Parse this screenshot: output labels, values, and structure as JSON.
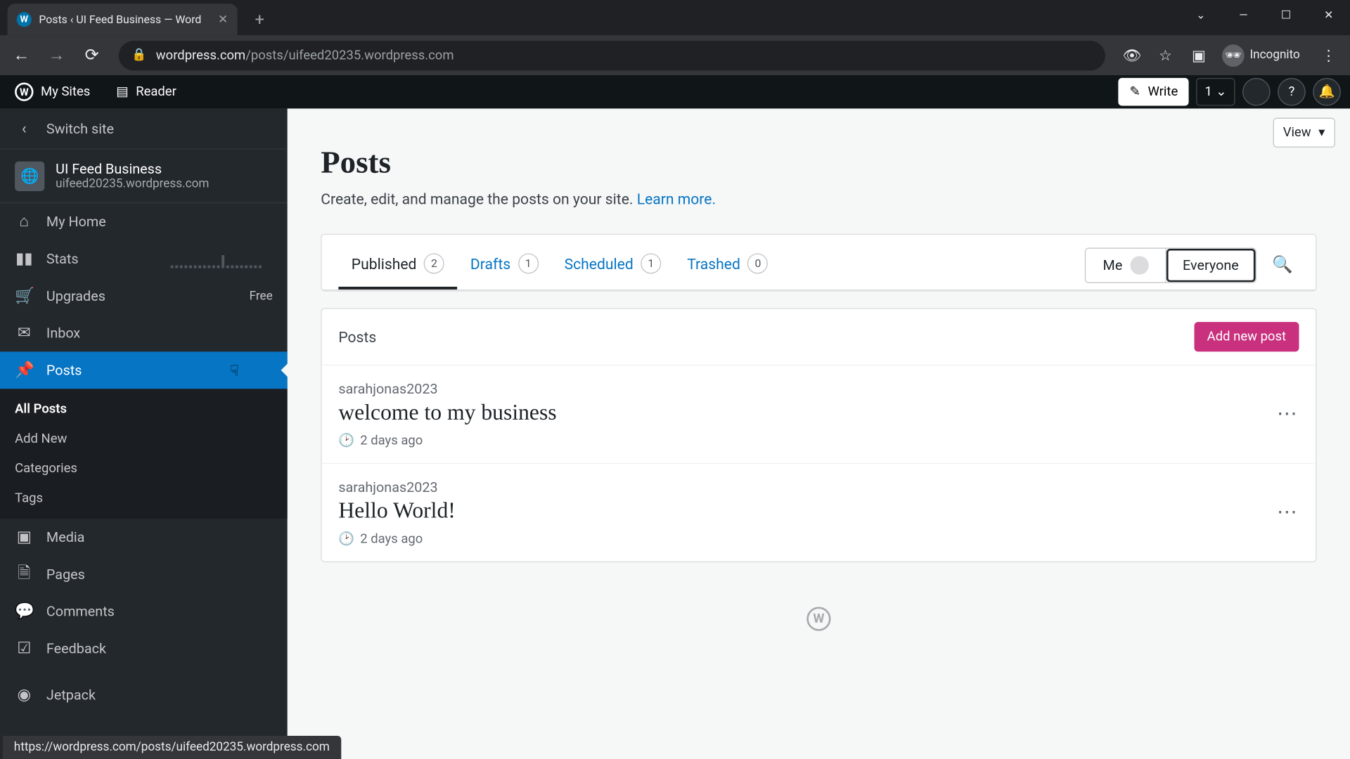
{
  "browser": {
    "tab_title": "Posts ‹ UI Feed Business — Word",
    "url_domain": "wordpress.com",
    "url_path": "/posts/uifeed20235.wordpress.com",
    "incognito_label": "Incognito"
  },
  "wpbar": {
    "my_sites": "My Sites",
    "reader": "Reader",
    "write": "Write",
    "notif_count": "1"
  },
  "sidebar": {
    "switch": "Switch site",
    "site_name": "UI Feed Business",
    "site_url": "uifeed20235.wordpress.com",
    "my_home": "My Home",
    "stats": "Stats",
    "upgrades": "Upgrades",
    "upgrades_badge": "Free",
    "inbox": "Inbox",
    "posts": "Posts",
    "all_posts": "All Posts",
    "add_new": "Add New",
    "categories": "Categories",
    "tags": "Tags",
    "media": "Media",
    "pages": "Pages",
    "comments": "Comments",
    "feedback": "Feedback",
    "jetpack": "Jetpack"
  },
  "main": {
    "view": "View",
    "title": "Posts",
    "subtitle": "Create, edit, and manage the posts on your site. ",
    "learn_more": "Learn more.",
    "tabs": [
      {
        "label": "Published",
        "count": "2"
      },
      {
        "label": "Drafts",
        "count": "1"
      },
      {
        "label": "Scheduled",
        "count": "1"
      },
      {
        "label": "Trashed",
        "count": "0"
      }
    ],
    "filter_me": "Me",
    "filter_everyone": "Everyone",
    "posts_header": "Posts",
    "add_new_post": "Add new post",
    "posts": [
      {
        "author": "sarahjonas2023",
        "title": "welcome to my business",
        "date": "2 days ago"
      },
      {
        "author": "sarahjonas2023",
        "title": "Hello World!",
        "date": "2 days ago"
      }
    ]
  },
  "status_url": "https://wordpress.com/posts/uifeed20235.wordpress.com"
}
